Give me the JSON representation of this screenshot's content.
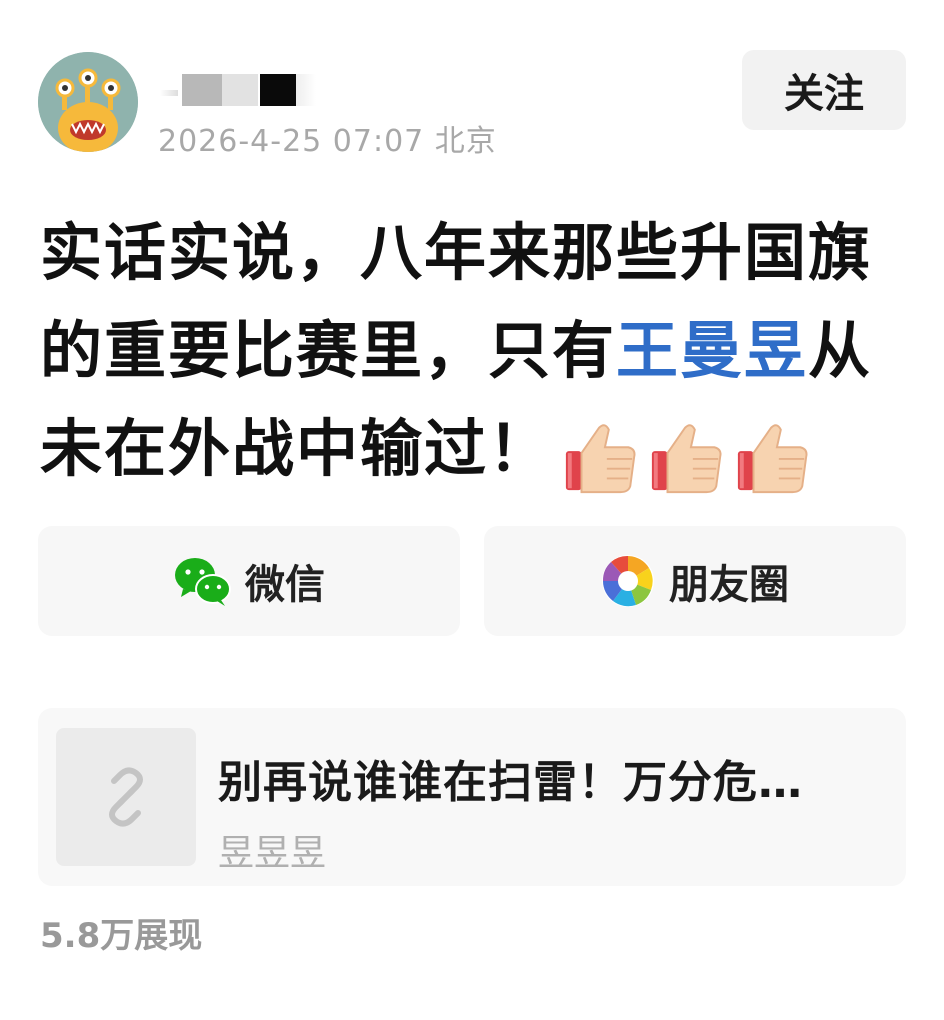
{
  "post": {
    "timestamp": "2026-4-25 07:07",
    "location": "北京",
    "follow_label": "关注",
    "text_part1": "实话实说，八年来那些升国旗的重要比赛里，只有",
    "mention": "王曼昱",
    "text_part2": "从未在外战中输过！",
    "emoji_icons": [
      "thumbs-up-icon",
      "thumbs-up-icon",
      "thumbs-up-icon"
    ]
  },
  "share": {
    "wechat_label": "微信",
    "moments_label": "朋友圈"
  },
  "link_card": {
    "title": "别再说谁谁在扫雷！万分危…",
    "source": "昱昱昱",
    "icon": "link-icon"
  },
  "stats": {
    "impressions": "5.8万展现"
  },
  "colors": {
    "mention": "#2f6dc8",
    "wechat_green": "#1aad19"
  }
}
